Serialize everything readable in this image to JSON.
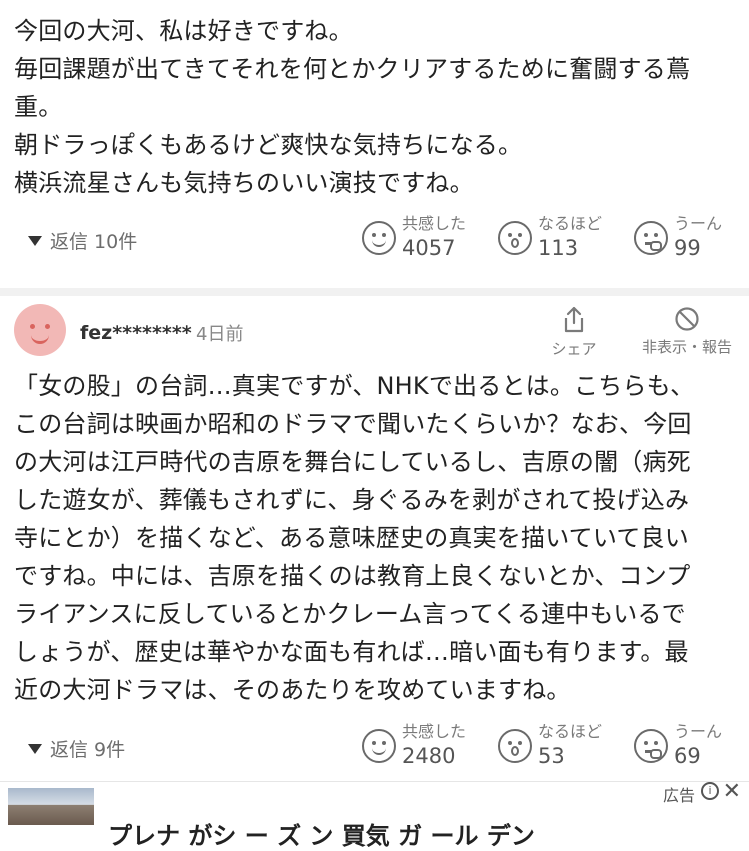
{
  "comment1": {
    "lines": [
      "今回の大河、私は好きですね。",
      "毎回課題が出てきてそれを何とかクリアするために奮闘する蔦",
      "重。",
      "朝ドラっぽくもあるけど爽快な気持ちになる。",
      "横浜流星さんも気持ちのいい演技ですね。"
    ],
    "replies_label": "返信 10件",
    "reactions": {
      "kyokan": {
        "label": "共感した",
        "count": "4057"
      },
      "naruhodo": {
        "label": "なるほど",
        "count": "113"
      },
      "uun": {
        "label": "うーん",
        "count": "99"
      }
    }
  },
  "comment2": {
    "username": "fez********",
    "time": "4日前",
    "share_label": "シェア",
    "report_label": "非表示・報告",
    "lines": [
      "「女の股」の台詞…真実ですが、NHKで出るとは。こちらも、",
      "この台詞は映画か昭和のドラマで聞いたくらいか？なお、今回",
      "の大河は江戸時代の吉原を舞台にしているし、吉原の闇（病死",
      "した遊女が、葬儀もされずに、身ぐるみを剥がされて投げ込み",
      "寺にとか）を描くなど、ある意味歴史の真実を描いていて良い",
      "ですね。中には、吉原を描くのは教育上良くないとか、コンプ",
      "ライアンスに反しているとかクレーム言ってくる連中もいるで",
      "しょうが、歴史は華やかな面も有れば…暗い面も有ります。最",
      "近の大河ドラマは、そのあたりを攻めていますね。"
    ],
    "replies_label": "返信 9件",
    "reactions": {
      "kyokan": {
        "label": "共感した",
        "count": "2480"
      },
      "naruhodo": {
        "label": "なるほど",
        "count": "53"
      },
      "uun": {
        "label": "うーん",
        "count": "69"
      }
    }
  },
  "ad": {
    "label": "広告",
    "info_symbol": "i",
    "close_symbol": "✕",
    "title": "プレナ がシ ー ズ ン 買気 ガ ール デン"
  }
}
